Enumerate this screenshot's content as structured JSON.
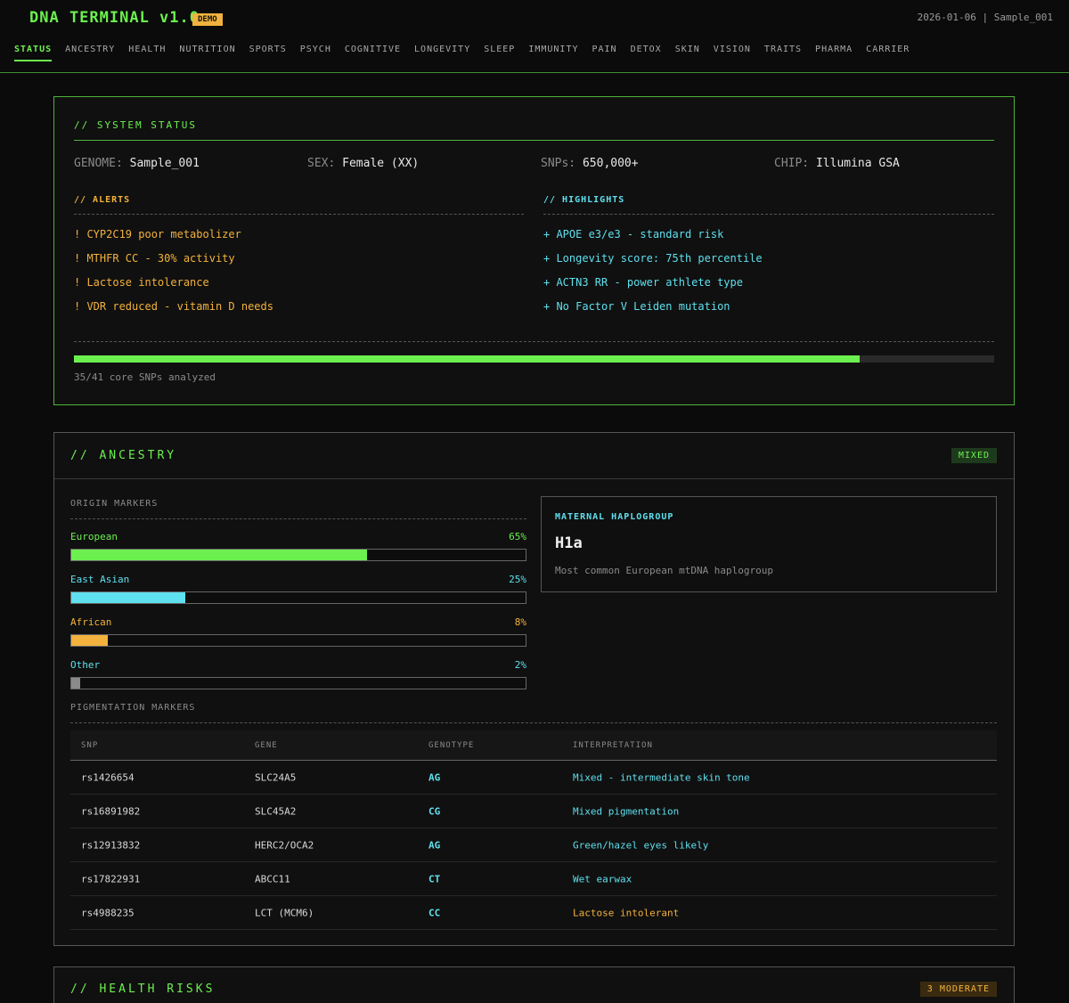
{
  "header": {
    "title": "DNA TERMINAL v1.0",
    "badge": "DEMO",
    "date": "2026-01-06",
    "separator": "|",
    "sample": "Sample_001"
  },
  "nav": {
    "tabs": [
      "STATUS",
      "ANCESTRY",
      "HEALTH",
      "NUTRITION",
      "SPORTS",
      "PSYCH",
      "COGNITIVE",
      "LONGEVITY",
      "SLEEP",
      "IMMUNITY",
      "PAIN",
      "DETOX",
      "SKIN",
      "VISION",
      "TRAITS",
      "PHARMA",
      "CARRIER"
    ],
    "active": "STATUS"
  },
  "status": {
    "title": "// SYSTEM STATUS",
    "info": [
      {
        "key": "GENOME:",
        "value": "Sample_001"
      },
      {
        "key": "SEX:",
        "value": "Female (XX)"
      },
      {
        "key": "SNPs:",
        "value": "650,000+"
      },
      {
        "key": "CHIP:",
        "value": "Illumina GSA"
      }
    ],
    "alerts_title": "// ALERTS",
    "alerts": [
      "! CYP2C19 poor metabolizer",
      "! MTHFR CC - 30% activity",
      "! Lactose intolerance",
      "! VDR reduced - vitamin D needs"
    ],
    "highlights_title": "// HIGHLIGHTS",
    "highlights": [
      "+ APOE e3/e3 - standard risk",
      "+ Longevity score: 75th percentile",
      "+ ACTN3 RR - power athlete type",
      "+ No Factor V Leiden mutation"
    ],
    "progress": {
      "done": 35,
      "total": 41
    },
    "progress_text": "35/41 core SNPs analyzed"
  },
  "ancestry": {
    "title": "// ANCESTRY",
    "badge": "MIXED",
    "origin_title": "ORIGIN MARKERS",
    "origins": [
      {
        "name": "European",
        "pct_label": "65%",
        "pct": 65,
        "color": "#6cf04f"
      },
      {
        "name": "East Asian",
        "pct_label": "25%",
        "pct": 25,
        "color": "#5fe0ee"
      },
      {
        "name": "African",
        "pct_label": "8%",
        "pct": 8,
        "color": "#f2b23d"
      },
      {
        "name": "Other",
        "pct_label": "2%",
        "pct": 2,
        "color": "#8a8a8a"
      }
    ],
    "haplogroup": {
      "title": "MATERNAL HAPLOGROUP",
      "value": "H1a",
      "desc": "Most common European mtDNA haplogroup"
    },
    "pig_title": "PIGMENTATION MARKERS",
    "columns": [
      "SNP",
      "GENE",
      "GENOTYPE",
      "INTERPRETATION"
    ],
    "rows": [
      {
        "snp": "rs1426654",
        "gene": "SLC24A5",
        "genotype": "AG",
        "interp": "Mixed - intermediate skin tone",
        "color": "#5fe0ee"
      },
      {
        "snp": "rs16891982",
        "gene": "SLC45A2",
        "genotype": "CG",
        "interp": "Mixed pigmentation",
        "color": "#5fe0ee"
      },
      {
        "snp": "rs12913832",
        "gene": "HERC2/OCA2",
        "genotype": "AG",
        "interp": "Green/hazel eyes likely",
        "color": "#5fe0ee"
      },
      {
        "snp": "rs17822931",
        "gene": "ABCC11",
        "genotype": "CT",
        "interp": "Wet earwax",
        "color": "#5fe0ee"
      },
      {
        "snp": "rs4988235",
        "gene": "LCT (MCM6)",
        "genotype": "CC",
        "interp": "Lactose intolerant",
        "color": "#f2b23d"
      }
    ]
  },
  "health": {
    "title": "// HEALTH RISKS",
    "badge": "3 MODERATE"
  },
  "colors": {
    "accent": "#6cf04f",
    "cyan": "#5fe0ee",
    "warning": "#f2b23d",
    "background": "#0b0b0b"
  }
}
